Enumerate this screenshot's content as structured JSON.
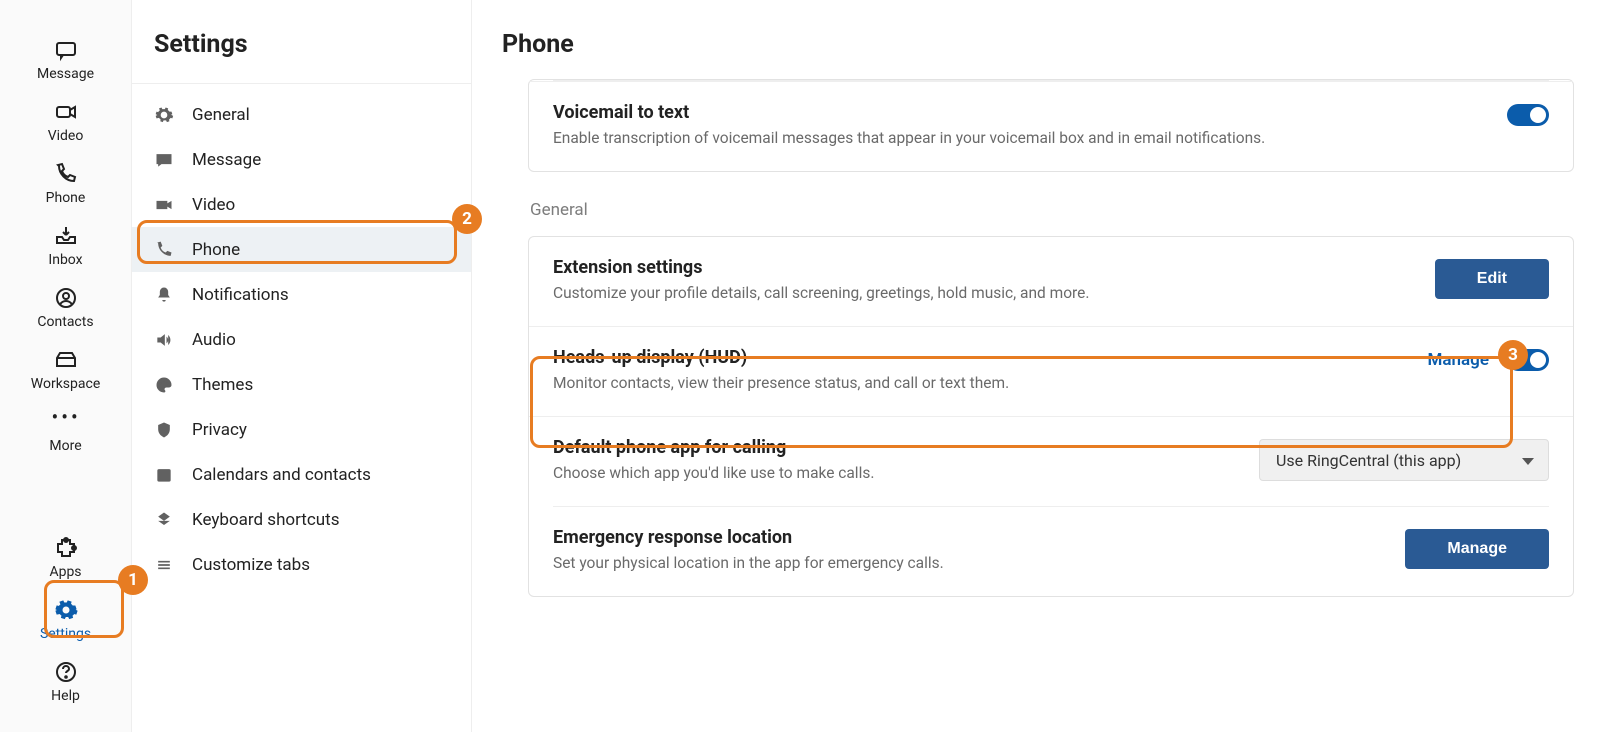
{
  "rail": {
    "items": [
      {
        "label": "Message"
      },
      {
        "label": "Video"
      },
      {
        "label": "Phone"
      },
      {
        "label": "Inbox"
      },
      {
        "label": "Contacts"
      },
      {
        "label": "Workspace"
      },
      {
        "label": "More"
      },
      {
        "label": "Apps"
      },
      {
        "label": "Settings"
      },
      {
        "label": "Help"
      }
    ]
  },
  "sidebar": {
    "title": "Settings",
    "items": [
      {
        "label": "General"
      },
      {
        "label": "Message"
      },
      {
        "label": "Video"
      },
      {
        "label": "Phone"
      },
      {
        "label": "Notifications"
      },
      {
        "label": "Audio"
      },
      {
        "label": "Themes"
      },
      {
        "label": "Privacy"
      },
      {
        "label": "Calendars and contacts"
      },
      {
        "label": "Keyboard shortcuts"
      },
      {
        "label": "Customize tabs"
      }
    ]
  },
  "main": {
    "title": "Phone",
    "voicemail": {
      "title": "Voicemail to text",
      "desc": "Enable transcription of voicemail messages that appear in your voicemail box and in email notifications."
    },
    "general_label": "General",
    "ext": {
      "title": "Extension settings",
      "desc": "Customize your profile details, call screening, greetings, hold music, and more.",
      "button": "Edit"
    },
    "hud": {
      "title": "Heads-up display (HUD)",
      "desc": "Monitor contacts, view their presence status, and call or text them.",
      "link": "Manage"
    },
    "default_app": {
      "title": "Default phone app for calling",
      "desc": "Choose which app you'd like use to make calls.",
      "selected": "Use RingCentral (this app)"
    },
    "emergency": {
      "title": "Emergency response location",
      "desc": "Set your physical location in the app for emergency calls.",
      "button": "Manage"
    }
  },
  "annotations": {
    "b1": "1",
    "b2": "2",
    "b3": "3"
  }
}
